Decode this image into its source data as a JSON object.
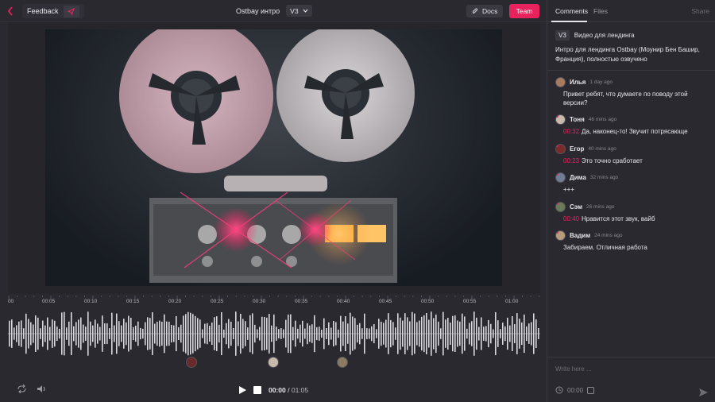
{
  "header": {
    "back_icon": "chevron-left-icon",
    "feedback_label": "Feedback",
    "title": "Ostbay интро",
    "version": "V3",
    "docs_label": "Docs",
    "team_label": "Team"
  },
  "colors": {
    "accent": "#e8225d",
    "background": "#2a2930",
    "panel": "#2a2930"
  },
  "timeline": {
    "ticks": [
      "00",
      "00:05",
      "00:10",
      "00:15",
      "00:20",
      "00:25",
      "00:30",
      "00:35",
      "00:40",
      "00:45",
      "00:50",
      "00:55",
      "01:00"
    ]
  },
  "player": {
    "current_time": "00:00",
    "separator": " / ",
    "duration": "01:05"
  },
  "panel": {
    "tabs": [
      {
        "label": "Comments",
        "active": true
      },
      {
        "label": "Files",
        "active": false
      }
    ],
    "share_label": "Share",
    "version_tag": "V3",
    "version_title": "Видео для лендинга",
    "description": "Интро для лендинга Ostbay (Моунир Бен Башир, Франция), полностью озвучено",
    "comments": [
      {
        "name": "Илья",
        "time": "1 day ago",
        "timestamp": "",
        "text": "Привет ребят, что думаете по поводу этой версии?",
        "unread": false
      },
      {
        "name": "Тоня",
        "time": "46 mins ago",
        "timestamp": "00:32",
        "text": "Да, наконец-то! Звучит потрясающе",
        "unread": true
      },
      {
        "name": "Егор",
        "time": "40 mins ago",
        "timestamp": "00:23",
        "text": "Это точно сработает",
        "unread": true
      },
      {
        "name": "Дима",
        "time": "32 mins ago",
        "timestamp": "",
        "text": "+++",
        "unread": true
      },
      {
        "name": "Сэм",
        "time": "26 mins ago",
        "timestamp": "00:40",
        "text": "Нравится этот звук, вайб",
        "unread": true
      },
      {
        "name": "Вадим",
        "time": "24 mins ago",
        "timestamp": "",
        "text": "Забираем. Отличная работа",
        "unread": true
      }
    ],
    "composer_placeholder": "Write here ...",
    "composer_time": "00:00"
  }
}
